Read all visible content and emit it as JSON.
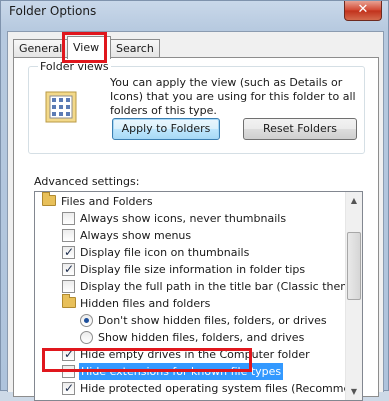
{
  "window": {
    "title": "Folder Options",
    "close_glyph": "✕"
  },
  "tabs": [
    {
      "label": "General"
    },
    {
      "label": "View"
    },
    {
      "label": "Search"
    }
  ],
  "folder_views": {
    "label": "Folder views",
    "description": "You can apply the view (such as Details or Icons) that you are using for this folder to all folders of this type.",
    "icon": "folder-views-icon",
    "apply_button": "Apply to Folders",
    "reset_button": "Reset Folders"
  },
  "advanced": {
    "label": "Advanced settings:",
    "items": [
      {
        "kind": "folder",
        "level": 0,
        "label": "Files and Folders"
      },
      {
        "kind": "checkbox",
        "level": 1,
        "checked": false,
        "label": "Always show icons, never thumbnails"
      },
      {
        "kind": "checkbox",
        "level": 1,
        "checked": false,
        "label": "Always show menus"
      },
      {
        "kind": "checkbox",
        "level": 1,
        "checked": true,
        "label": "Display file icon on thumbnails"
      },
      {
        "kind": "checkbox",
        "level": 1,
        "checked": true,
        "label": "Display file size information in folder tips"
      },
      {
        "kind": "checkbox",
        "level": 1,
        "checked": false,
        "label": "Display the full path in the title bar (Classic theme only)"
      },
      {
        "kind": "folder",
        "level": 1,
        "label": "Hidden files and folders"
      },
      {
        "kind": "radio",
        "level": 2,
        "checked": true,
        "label": "Don't show hidden files, folders, or drives"
      },
      {
        "kind": "radio",
        "level": 2,
        "checked": false,
        "label": "Show hidden files, folders, and drives"
      },
      {
        "kind": "checkbox",
        "level": 1,
        "checked": true,
        "label": "Hide empty drives in the Computer folder"
      },
      {
        "kind": "checkbox",
        "level": 1,
        "checked": false,
        "label": "Hide extensions for known file types",
        "selected": true
      },
      {
        "kind": "checkbox",
        "level": 1,
        "checked": true,
        "label": "Hide protected operating system files (Recommended)"
      }
    ]
  },
  "colors": {
    "highlight": "#e0171d",
    "selection": "#3399ff"
  }
}
